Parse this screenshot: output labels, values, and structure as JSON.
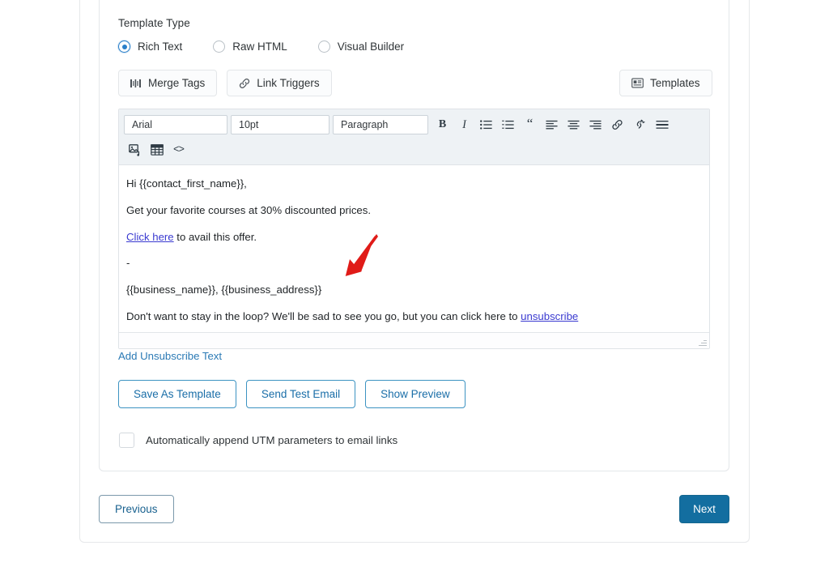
{
  "section": {
    "label": "Template Type"
  },
  "template_type": {
    "options": [
      {
        "label": "Rich Text",
        "checked": true
      },
      {
        "label": "Raw HTML",
        "checked": false
      },
      {
        "label": "Visual Builder",
        "checked": false
      }
    ]
  },
  "actions": {
    "merge_tags": "Merge Tags",
    "link_triggers": "Link Triggers",
    "templates": "Templates"
  },
  "editor_toolbar": {
    "font_family": "Arial",
    "font_size": "10pt",
    "block_format": "Paragraph",
    "buttons": [
      "bold",
      "italic",
      "bullet-list",
      "numbered-list",
      "blockquote",
      "align-left",
      "align-center",
      "align-right",
      "insert-link",
      "remove-link",
      "horizontal-rule"
    ],
    "buttons_row2": [
      "insert-image",
      "insert-table",
      "source-code"
    ]
  },
  "email_body": {
    "greeting": "Hi {{contact_first_name}},",
    "offer": "Get your favorite courses at 30% discounted prices.",
    "cta_link": "Click here",
    "cta_rest": " to avail this offer.",
    "divider": "-",
    "signature": "{{business_name}}, {{business_address}}",
    "unsub_prefix": "Don't want to stay in the loop? We'll be sad to see you go, but you can click here to ",
    "unsub_link": "unsubscribe"
  },
  "links": {
    "add_unsubscribe": "Add Unsubscribe Text"
  },
  "outline_buttons": [
    "Save As Template",
    "Send Test Email",
    "Show Preview"
  ],
  "utm": {
    "label": "Automatically append UTM parameters to email links",
    "checked": false
  },
  "navigation": {
    "previous": "Previous",
    "next": "Next"
  },
  "colors": {
    "accent_blue": "#136ea0",
    "outline_blue": "#3c93c2",
    "link_blue": "#2b7ab5",
    "toolbar_bg": "#eef2f5",
    "annotation_red": "#e01b18"
  }
}
